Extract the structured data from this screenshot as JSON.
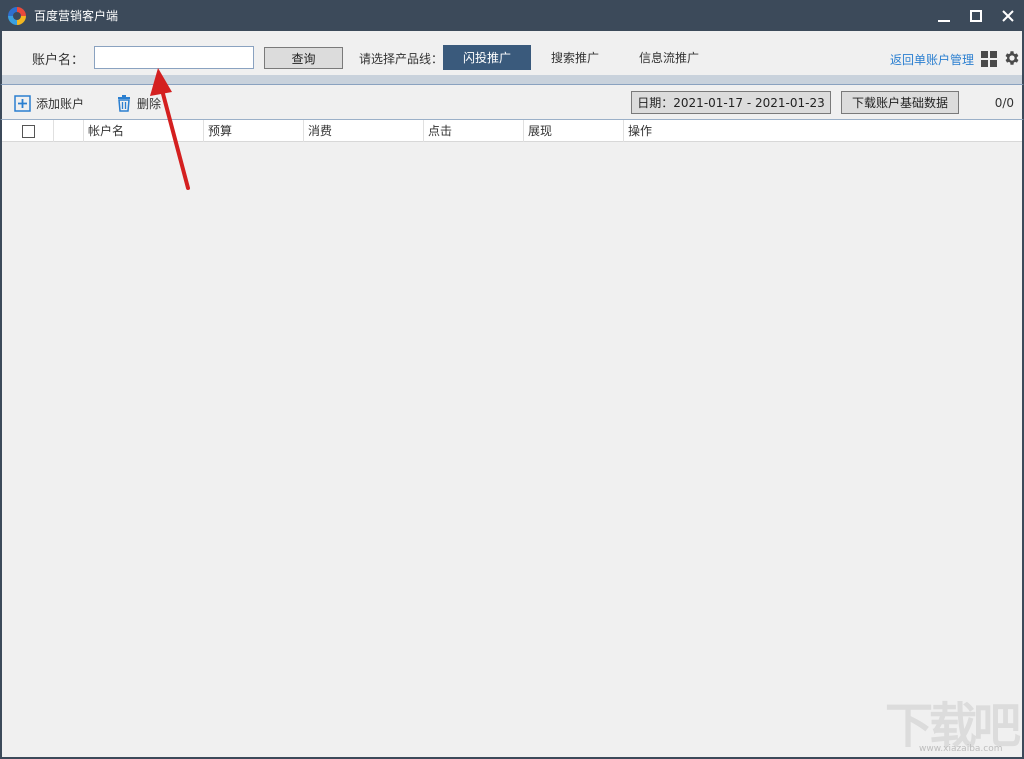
{
  "window": {
    "title": "百度营销客户端"
  },
  "toolbar": {
    "account_label": "账户名：",
    "account_value": "",
    "query_label": "查询",
    "product_label": "请选择产品线：",
    "tabs": [
      {
        "label": "闪投推广",
        "active": true
      },
      {
        "label": "搜索推广",
        "active": false
      },
      {
        "label": "信息流推广",
        "active": false
      }
    ],
    "return_label": "返回单账户管理"
  },
  "actions": {
    "add_label": "添加账户",
    "delete_label": "删除",
    "date_label": "日期：2021-01-17 - 2021-01-23",
    "download_label": "下载账户基础数据",
    "page_count": "0/0"
  },
  "table": {
    "columns": [
      "帐户名",
      "预算",
      "消费",
      "点击",
      "展现",
      "操作"
    ]
  },
  "watermark": {
    "text": "下载吧",
    "sub": "www.xiazaiba.com"
  },
  "colors": {
    "titlebar": "#3c4a5a",
    "active_tab": "#3a5a7c",
    "link": "#2b7fd0",
    "arrow": "#d42020"
  }
}
